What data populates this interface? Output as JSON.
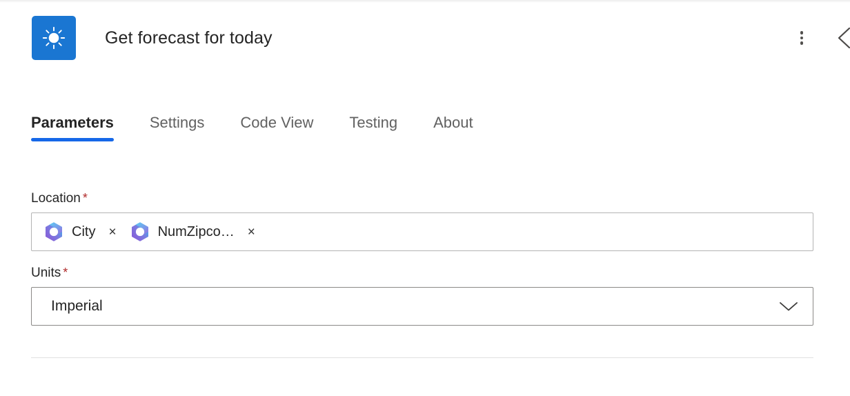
{
  "header": {
    "title": "Get forecast for today",
    "app_icon": "sun-icon",
    "app_icon_bg": "#1a76d2",
    "actions": [
      {
        "name": "more-options-button",
        "icon": "kebab-menu-icon",
        "label": ""
      },
      {
        "name": "collapse-panel-button",
        "icon": "chevron-left-icon",
        "label": ""
      }
    ]
  },
  "tabs": [
    {
      "label": "Parameters",
      "active": true
    },
    {
      "label": "Settings",
      "active": false
    },
    {
      "label": "Code View",
      "active": false
    },
    {
      "label": "Testing",
      "active": false
    },
    {
      "label": "About",
      "active": false
    }
  ],
  "form": {
    "location": {
      "label": "Location",
      "required_marker": "*",
      "tokens": [
        {
          "text": "City",
          "icon": "copilot-icon",
          "remove": "×"
        },
        {
          "text": "NumZipco…",
          "icon": "copilot-icon",
          "remove": "×"
        }
      ]
    },
    "units": {
      "label": "Units",
      "required_marker": "*",
      "value": "Imperial",
      "chevron": "chevron-down-icon"
    }
  },
  "colors": {
    "accent": "#1668e8",
    "app_tile": "#1a76d2",
    "required": "#b02a2a",
    "text": "#242424",
    "muted_text": "#616161"
  }
}
